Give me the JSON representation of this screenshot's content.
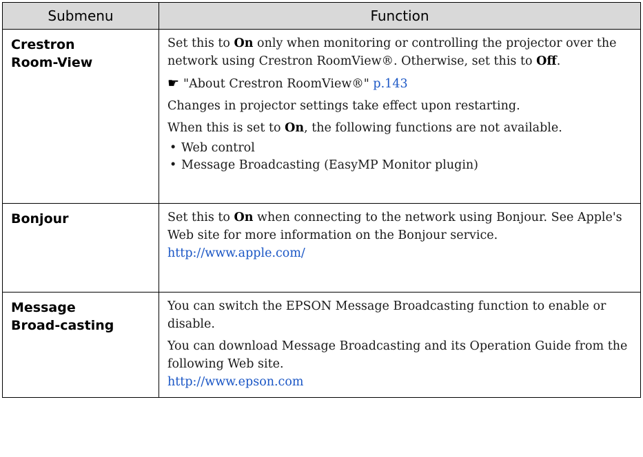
{
  "table": {
    "headers": [
      "Submenu",
      "Function"
    ],
    "rows": {
      "crestron": {
        "submenu": "Crestron Room-View",
        "p1_a": "Set this to ",
        "p1_b": "On",
        "p1_c": " only when monitoring or controlling the projector over the network using Crestron RoomView®. Otherwise, set this to ",
        "p1_d": "Off",
        "p1_e": ".",
        "ref_text": "\"About Crestron RoomView®\" ",
        "ref_page": "p.143",
        "p2": "Changes in projector settings take effect upon restarting.",
        "p3_a": "When this is set to ",
        "p3_b": "On",
        "p3_c": ", the following functions are not available.",
        "bullets": [
          "Web control",
          "Message Broadcasting (EasyMP Monitor plugin)"
        ]
      },
      "bonjour": {
        "submenu": "Bonjour",
        "p1_a": "Set this to ",
        "p1_b": "On",
        "p1_c": " when connecting to the network using Bonjour. See Apple's Web site for more information on the Bonjour service.",
        "link": "http://www.apple.com/"
      },
      "message": {
        "submenu": "Message Broad-casting",
        "p1": "You can switch the EPSON Message Broadcasting function to enable or disable.",
        "p2": "You can download Message Broadcasting and its Operation Guide from the following Web site.",
        "link": "http://www.epson.com"
      }
    }
  },
  "icons": {
    "reference": "pointing-hand-icon"
  },
  "colors": {
    "header_bg": "#d9d9d9",
    "link": "#1a56c5",
    "border": "#000000"
  }
}
